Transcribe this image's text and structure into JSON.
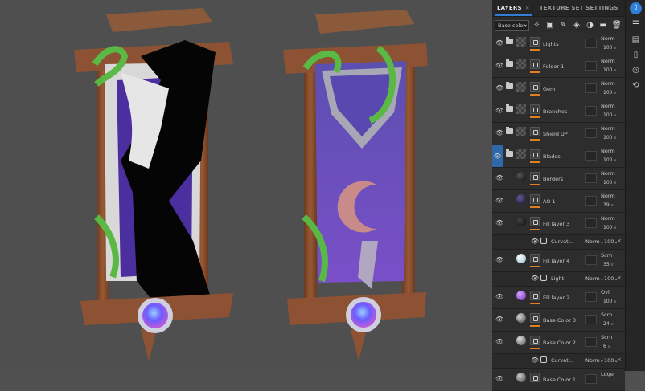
{
  "panel": {
    "tabs": [
      {
        "label": "LAYERS",
        "active": true,
        "close": "×"
      },
      {
        "label": "TEXTURE SET SETTINGS",
        "active": false
      }
    ],
    "channel_select": "Base color",
    "toolbar_icons": [
      "add-effect-icon",
      "add-mask-icon",
      "paint-layer-icon",
      "fill-layer-icon",
      "smart-material-icon",
      "folder-icon",
      "delete-icon"
    ],
    "layers": [
      {
        "kind": "folder",
        "name": "Lights",
        "blend": "Norm",
        "opacity": "100",
        "thumb": "folder"
      },
      {
        "kind": "folder",
        "name": "Folder 1",
        "blend": "Norm",
        "opacity": "100",
        "thumb": "folder"
      },
      {
        "kind": "folder",
        "name": "Gem",
        "blend": "Norm",
        "opacity": "100",
        "thumb": "folder"
      },
      {
        "kind": "folder",
        "name": "Branches",
        "blend": "Norm",
        "opacity": "100",
        "thumb": "folder"
      },
      {
        "kind": "folder",
        "name": "Shield UP",
        "blend": "Norm",
        "opacity": "100",
        "thumb": "folder"
      },
      {
        "kind": "folder",
        "name": "Blades",
        "blend": "Norm",
        "opacity": "100",
        "thumb": "folder",
        "selected": true
      },
      {
        "kind": "layer",
        "name": "Borders",
        "blend": "Norm",
        "opacity": "100",
        "thumb_color": "#1d1d1d"
      },
      {
        "kind": "layer",
        "name": "AO 1",
        "blend": "Norm",
        "opacity": "39",
        "thumb_color": "#221d33"
      },
      {
        "kind": "layer",
        "name": "Fill layer 3",
        "blend": "Norm",
        "opacity": "100",
        "thumb_color": "#1c1c1c"
      },
      {
        "kind": "mask",
        "name": "Curvat...",
        "blend": "Norm",
        "opacity": "100"
      },
      {
        "kind": "layer",
        "name": "Fill layer 4",
        "blend": "Scrn",
        "opacity": "35",
        "thumb_color": "#cfe3ea"
      },
      {
        "kind": "mask",
        "name": "Light",
        "blend": "Norm",
        "opacity": "100"
      },
      {
        "kind": "layer",
        "name": "Fill layer 2",
        "blend": "Ovl",
        "opacity": "100",
        "thumb_color": "#9b5fd6"
      },
      {
        "kind": "layer",
        "name": "Base Color 3",
        "blend": "Scrn",
        "opacity": "24",
        "thumb_color": "#8a8a8a"
      },
      {
        "kind": "layer",
        "name": "Base Color 2",
        "blend": "Scrn",
        "opacity": "6",
        "thumb_color": "#9a9a9a"
      },
      {
        "kind": "mask",
        "name": "Curvat...",
        "blend": "Norm",
        "opacity": "100"
      },
      {
        "kind": "layer",
        "name": "Base Color 1",
        "blend": "Ldge",
        "opacity": "",
        "thumb_color": "#8c8c8c"
      }
    ]
  },
  "rightbar_icons": [
    "share-icon",
    "layers-stack-icon",
    "texture-set-icon",
    "properties-icon",
    "display-settings-icon",
    "history-icon"
  ],
  "colors": {
    "accent": "#2f7fd6",
    "opacity_bar": "#e0801e",
    "selected": "#2f67a8"
  }
}
